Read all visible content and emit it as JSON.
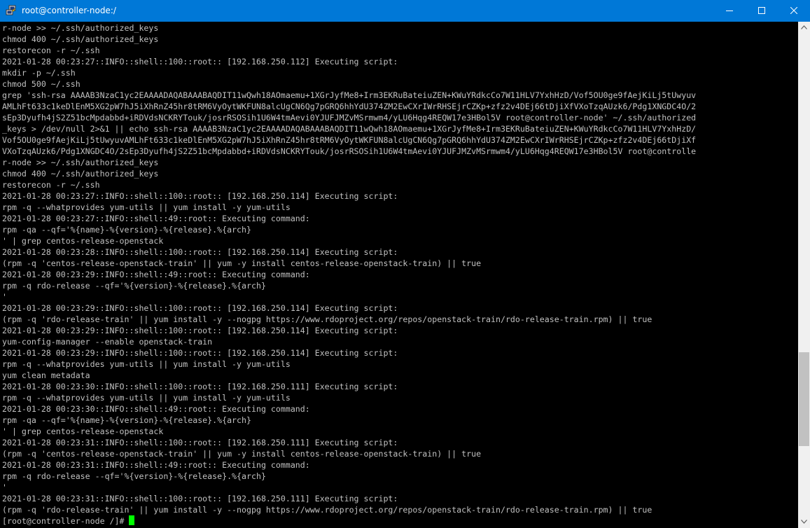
{
  "window": {
    "title": "root@controller-node:/",
    "app_icon": "putty-icon",
    "controls": [
      "minimize-icon",
      "maximize-icon",
      "close-icon"
    ]
  },
  "colors": {
    "titlebar": "#0078d7",
    "terminal_bg": "#000000",
    "terminal_fg": "#c0c0c0",
    "cursor": "#00ff00",
    "scrollbar_track": "#f0f0f0",
    "scrollbar_thumb": "#c1c1c1"
  },
  "terminal": {
    "lines": [
      "r-node >> ~/.ssh/authorized_keys",
      "chmod 400 ~/.ssh/authorized_keys",
      "restorecon -r ~/.ssh",
      "2021-01-28 00:23:27::INFO::shell::100::root:: [192.168.250.112] Executing script:",
      "mkdir -p ~/.ssh",
      "chmod 500 ~/.ssh",
      "grep 'ssh-rsa AAAAB3NzaC1yc2EAAAADAQABAAABAQDIT11wQwh18AOmaemu+1XGrJyfMe8+Irm3EKRuBateiuZEN+KWuYRdkcCo7W11HLV7YxhHzD/Vof5OU0ge9fAejKiLj5tUwyuv",
      "AMLhFt633c1keDlEnM5XG2pW7hJ5iXhRnZ45hr8tRM6VyOytWKFUN8alcUgCN6Qg7pGRQ6hhYdU374ZM2EwCXrIWrRHSEjrCZKp+zfz2v4DEj66tDjiXfVXoTzqAUzk6/Pdg1XNGDC4O/2",
      "sEp3Dyufh4jS2Z51bcMpdabbd+iRDVdsNCKRYTouk/josrRSOSih1U6W4tmAevi0YJUFJMZvMSrmwm4/yLU6Hqg4REQW17e3HBol5V root@controller-node' ~/.ssh/authorized",
      "_keys > /dev/null 2>&1 || echo ssh-rsa AAAAB3NzaC1yc2EAAAADAQABAAABAQDIT11wQwh18AOmaemu+1XGrJyfMe8+Irm3EKRuBateiuZEN+KWuYRdkcCo7W11HLV7YxhHzD/",
      "Vof5OU0ge9fAejKiLj5tUwyuvAMLhFt633c1keDlEnM5XG2pW7hJ5iXhRnZ45hr8tRM6VyOytWKFUN8alcUgCN6Qg7pGRQ6hhYdU374ZM2EwCXrIWrRHSEjrCZKp+zfz2v4DEj66tDjiXf",
      "VXoTzqAUzk6/Pdg1XNGDC4O/2sEp3Dyufh4jS2Z51bcMpdabbd+iRDVdsNCKRYTouk/josrRSOSih1U6W4tmAevi0YJUFJMZvMSrmwm4/yLU6Hqg4REQW17e3HBol5V root@controlle",
      "r-node >> ~/.ssh/authorized_keys",
      "chmod 400 ~/.ssh/authorized_keys",
      "restorecon -r ~/.ssh",
      "2021-01-28 00:23:27::INFO::shell::100::root:: [192.168.250.114] Executing script:",
      "rpm -q --whatprovides yum-utils || yum install -y yum-utils",
      "2021-01-28 00:23:27::INFO::shell::49::root:: Executing command:",
      "rpm -qa --qf='%{name}-%{version}-%{release}.%{arch}",
      "' | grep centos-release-openstack",
      "2021-01-28 00:23:28::INFO::shell::100::root:: [192.168.250.114] Executing script:",
      "(rpm -q 'centos-release-openstack-train' || yum -y install centos-release-openstack-train) || true",
      "2021-01-28 00:23:29::INFO::shell::49::root:: Executing command:",
      "rpm -q rdo-release --qf='%{version}-%{release}.%{arch}",
      "'",
      "2021-01-28 00:23:29::INFO::shell::100::root:: [192.168.250.114] Executing script:",
      "(rpm -q 'rdo-release-train' || yum install -y --nogpg https://www.rdoproject.org/repos/openstack-train/rdo-release-train.rpm) || true",
      "2021-01-28 00:23:29::INFO::shell::100::root:: [192.168.250.114] Executing script:",
      "yum-config-manager --enable openstack-train",
      "2021-01-28 00:23:29::INFO::shell::100::root:: [192.168.250.114] Executing script:",
      "rpm -q --whatprovides yum-utils || yum install -y yum-utils",
      "yum clean metadata",
      "2021-01-28 00:23:30::INFO::shell::100::root:: [192.168.250.111] Executing script:",
      "rpm -q --whatprovides yum-utils || yum install -y yum-utils",
      "2021-01-28 00:23:30::INFO::shell::49::root:: Executing command:",
      "rpm -qa --qf='%{name}-%{version}-%{release}.%{arch}",
      "' | grep centos-release-openstack",
      "2021-01-28 00:23:31::INFO::shell::100::root:: [192.168.250.111] Executing script:",
      "(rpm -q 'centos-release-openstack-train' || yum -y install centos-release-openstack-train) || true",
      "2021-01-28 00:23:31::INFO::shell::49::root:: Executing command:",
      "rpm -q rdo-release --qf='%{version}-%{release}.%{arch}",
      "'",
      "2021-01-28 00:23:31::INFO::shell::100::root:: [192.168.250.111] Executing script:",
      "(rpm -q 'rdo-release-train' || yum install -y --nogpg https://www.rdoproject.org/repos/openstack-train/rdo-release-train.rpm) || true"
    ],
    "prompt": "[root@controller-node /]# "
  },
  "scrollbar": {
    "position_fraction": 0.82
  }
}
